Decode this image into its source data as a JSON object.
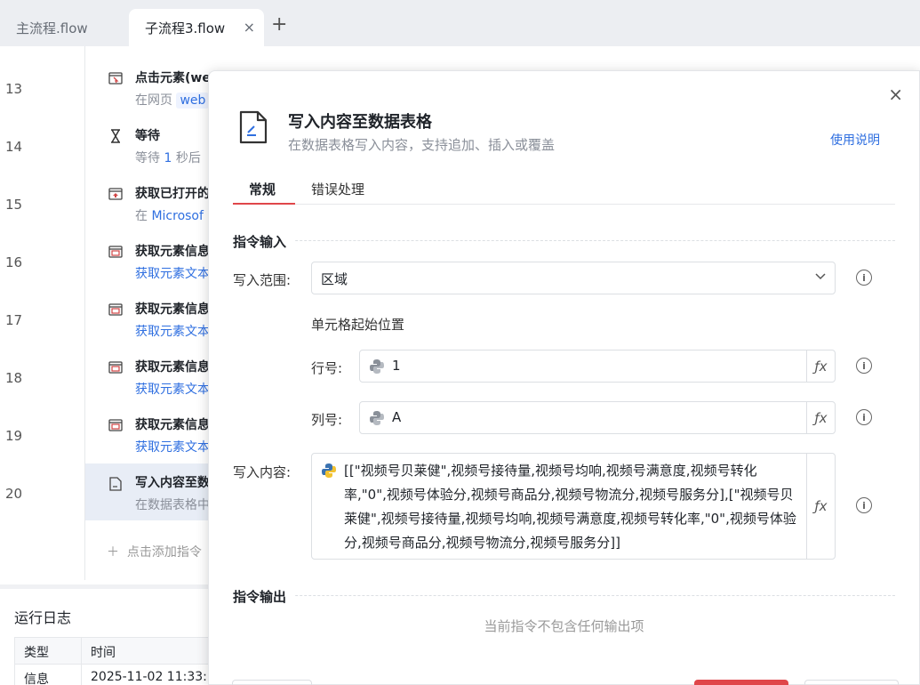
{
  "tabs": [
    {
      "label": "主流程.flow"
    },
    {
      "label": "子流程3.flow"
    }
  ],
  "tab_close": "×",
  "tab_add": "+",
  "steps": [
    {
      "line": "13",
      "title": "点击元素(we",
      "desc_prefix": "在网页",
      "desc_chip": "web"
    },
    {
      "line": "14",
      "title": "等待",
      "desc_prefix": "等待",
      "desc_value": "1",
      "desc_suffix": "秒后"
    },
    {
      "line": "15",
      "title": "获取已打开的",
      "desc_prefix": "在",
      "desc_value": "Microsof"
    },
    {
      "line": "16",
      "title": "获取元素信息",
      "desc": "获取元素文本"
    },
    {
      "line": "17",
      "title": "获取元素信息",
      "desc": "获取元素文本"
    },
    {
      "line": "18",
      "title": "获取元素信息",
      "desc": "获取元素文本"
    },
    {
      "line": "19",
      "title": "获取元素信息",
      "desc": "获取元素文本"
    },
    {
      "line": "20",
      "title": "写入内容至数",
      "desc": "在数据表格中"
    }
  ],
  "add_step": "点击添加指令",
  "log": {
    "title": "运行日志",
    "headers": [
      "类型",
      "时间"
    ],
    "rows": [
      [
        "信息",
        "2025-11-02 11:33:"
      ]
    ]
  },
  "modal": {
    "title": "写入内容至数据表格",
    "subtitle": "在数据表格写入内容，支持追加、插入或覆盖",
    "help": "使用说明",
    "close": "×",
    "tabs": [
      "常规",
      "错误处理"
    ],
    "input_section": "指令输入",
    "output_section": "指令输出",
    "range_label": "写入范围:",
    "range_value": "区域",
    "cell_start_label": "单元格起始位置",
    "row_label": "行号:",
    "row_value": "1",
    "col_label": "列号:",
    "col_value": "A",
    "content_label": "写入内容:",
    "content_value": "[[\"视频号贝莱健\",视频号接待量,视频号均响,视频号满意度,视频号转化率,\"0\",视频号体验分,视频号商品分,视频号物流分,视频号服务分],[\"视频号贝莱健\",视频号接待量,视频号均响,视频号满意度,视频号转化率,\"0\",视频号体验分,视频号商品分,视频号物流分,视频号服务分]]",
    "fx": "ƒx",
    "info": "i",
    "empty_output": "当前指令不包含任何输出项"
  },
  "colors": {
    "accent_red": "#e0464a",
    "link_blue": "#2f6fe0"
  }
}
